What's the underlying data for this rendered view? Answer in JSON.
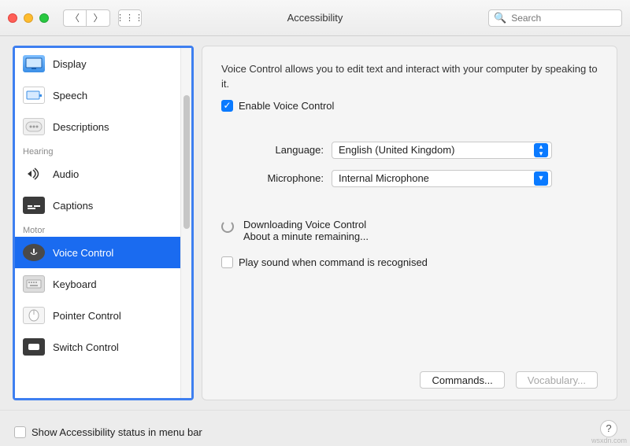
{
  "window": {
    "title": "Accessibility",
    "search_placeholder": "Search"
  },
  "sidebar": {
    "items": [
      {
        "label": "Display"
      },
      {
        "label": "Speech"
      },
      {
        "label": "Descriptions"
      }
    ],
    "hearing_label": "Hearing",
    "hearing_items": [
      {
        "label": "Audio"
      },
      {
        "label": "Captions"
      }
    ],
    "motor_label": "Motor",
    "motor_items": [
      {
        "label": "Voice Control"
      },
      {
        "label": "Keyboard"
      },
      {
        "label": "Pointer Control"
      },
      {
        "label": "Switch Control"
      }
    ]
  },
  "pane": {
    "description": "Voice Control allows you to edit text and interact with your computer by speaking to it.",
    "enable_label": "Enable Voice Control",
    "language_label": "Language:",
    "language_value": "English (United Kingdom)",
    "microphone_label": "Microphone:",
    "microphone_value": "Internal Microphone",
    "downloading_line1": "Downloading Voice Control",
    "downloading_line2": "About a minute remaining...",
    "play_sound_label": "Play sound when command is recognised",
    "commands_btn": "Commands...",
    "vocab_btn": "Vocabulary..."
  },
  "bottom": {
    "status_label": "Show Accessibility status in menu bar"
  },
  "watermark": "wsxdn.com"
}
